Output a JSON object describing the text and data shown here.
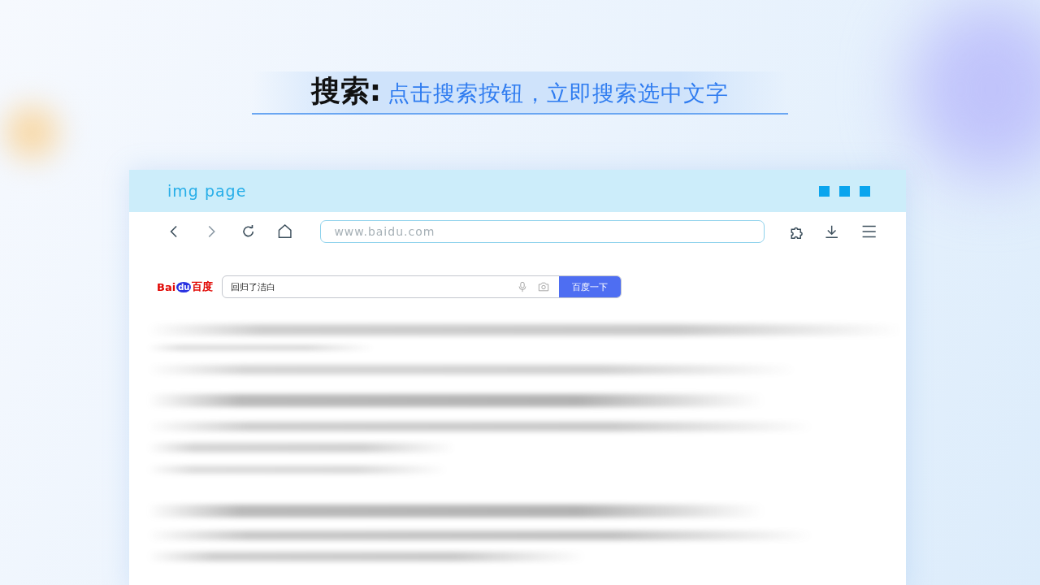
{
  "headline": {
    "label": "搜索:",
    "text": "点击搜索按钮，立即搜索选中文字"
  },
  "window": {
    "title": "img page"
  },
  "address_bar": {
    "placeholder": "www.baidu.com"
  },
  "page": {
    "logo": {
      "part_1": "Bai",
      "part_2": "du",
      "part_3": "百度"
    },
    "search": {
      "value": "回归了洁白",
      "button": "百度一下"
    }
  }
}
